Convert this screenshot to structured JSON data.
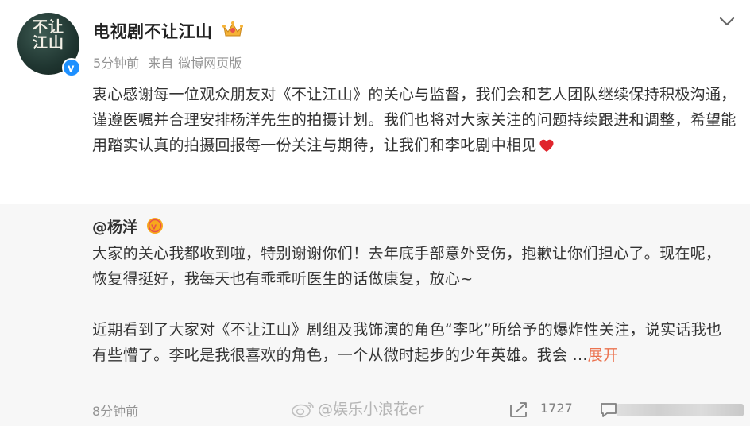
{
  "post": {
    "author_name": "电视剧不让江山",
    "avatar_text": "不让江山",
    "time": "5分钟前",
    "source_prefix": "来自",
    "source": "微博网页版",
    "content": "衷心感谢每一位观众朋友对《不让江山》的关心与监督，我们会和艺人团队继续保持积极沟通，谨遵医嘱并合理安排杨洋先生的拍摄计划。我们也将对大家关注的问题持续跟进和调整，希望能用踏实认真的拍摄回报每一份关注与期待，让我们和李叱剧中相见"
  },
  "repost": {
    "author": "@杨洋",
    "para1": "大家的关心我都收到啦，特别谢谢你们！去年底手部意外受伤，抱歉让你们担心了。现在呢，恢复得挺好，我每天也有乖乖听医生的话做康复，放心~",
    "para2": "近期看到了大家对《不让江山》剧组及我饰演的角色“李叱”所给予的爆炸性关注，说实话我也有些懵了。李叱是我很喜欢的角色，一个从微时起步的少年英雄。我会 ...",
    "expand_label": "展开",
    "time": "8分钟前",
    "repost_count": "1727"
  },
  "watermark": {
    "text": "@娱乐小浪花er"
  },
  "icons": {
    "verify": "verified-badge-icon",
    "crown": "crown-icon",
    "chevron": "chevron-down-icon",
    "heart": "heart-icon",
    "gold": "gold-v-badge-icon",
    "share": "share-icon",
    "comment": "comment-icon"
  },
  "colors": {
    "accent_link": "#eb7350",
    "meta_gray": "#939393",
    "repost_bg": "#f7f7f7",
    "verify_blue": "#1e90ff"
  }
}
